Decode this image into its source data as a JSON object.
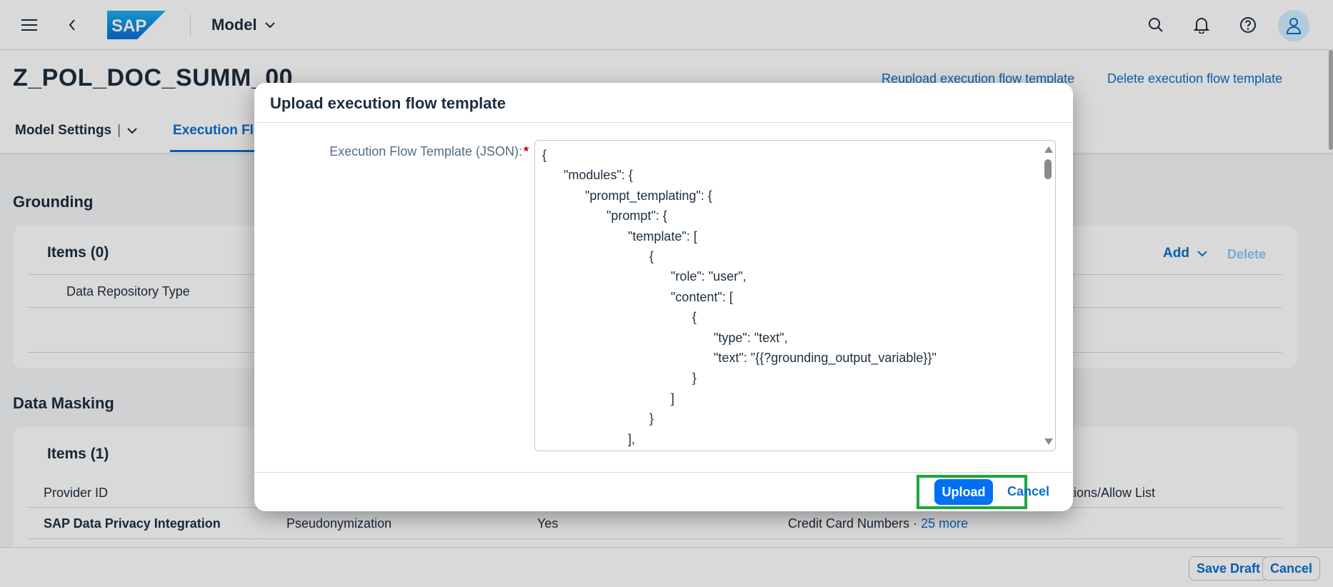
{
  "shell": {
    "logo_text": "SAP",
    "title": "Model"
  },
  "object": {
    "title": "Z_POL_DOC_SUMM_00",
    "actions": {
      "reupload": "Reupload execution flow template",
      "delete": "Delete execution flow template"
    },
    "tabs": [
      {
        "label": "Model Settings"
      },
      {
        "label": "Execution Fl"
      }
    ]
  },
  "grounding": {
    "title": "Grounding",
    "items_title": "Items (0)",
    "add_label": "Add",
    "delete_label": "Delete",
    "column": "Data Repository Type"
  },
  "data_masking": {
    "title": "Data Masking",
    "items_title": "Items (1)",
    "columns": [
      "Provider ID",
      "ptions/Allow List"
    ],
    "row": {
      "provider": "SAP Data Privacy Integration",
      "method": "Pseudonymization",
      "enabled": "Yes",
      "entities": "Credit Card Numbers ·",
      "more": "25 more"
    }
  },
  "footer": {
    "save_draft": "Save Draft",
    "cancel": "Cancel"
  },
  "dialog": {
    "title": "Upload execution flow template",
    "field_label": "Execution Flow Template (JSON):",
    "required_mark": "*",
    "json_text": "{\n\t\"modules\": {\n\t\t\"prompt_templating\": {\n\t\t\t\"prompt\": {\n\t\t\t\t\"template\": [\n\t\t\t\t\t{\n\t\t\t\t\t\t\"role\": \"user\",\n\t\t\t\t\t\t\"content\": [\n\t\t\t\t\t\t\t{\n\t\t\t\t\t\t\t\t\"type\": \"text\",\n\t\t\t\t\t\t\t\t\"text\": \"{{?grounding_output_variable}}\"\n\t\t\t\t\t\t\t}\n\t\t\t\t\t\t]\n\t\t\t\t\t}\n\t\t\t\t],\n\t\t\t\t\"defaults\": {",
    "upload_label": "Upload",
    "cancel_label": "Cancel"
  },
  "colors": {
    "brand_blue": "#0070f2",
    "link_blue": "#0a6ed1",
    "highlight_green": "#1fa63a"
  }
}
